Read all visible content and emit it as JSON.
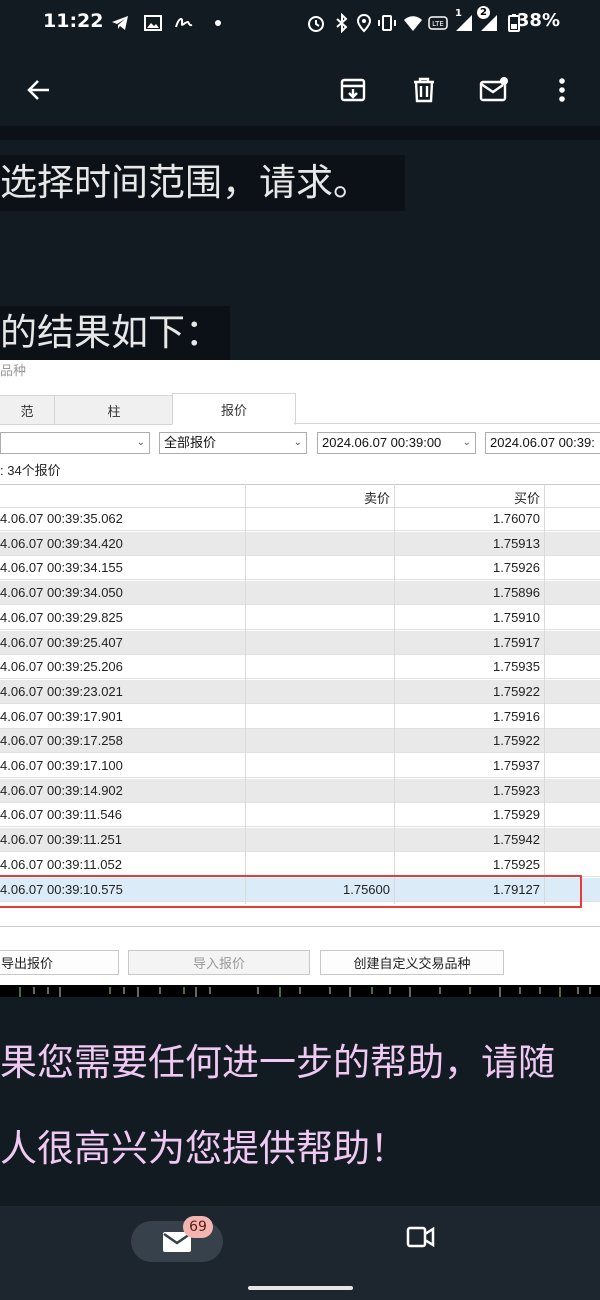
{
  "status_bar": {
    "time": "11:22",
    "battery_pct": "38%",
    "icons": [
      "telegram-icon",
      "image-icon",
      "signature-icon",
      "dot-icon",
      "alarm-icon",
      "bluetooth-icon",
      "location-icon",
      "vibrate-icon",
      "wifi-6-icon",
      "volte-icon",
      "signal-1-icon",
      "signal-2-icon",
      "battery-icon"
    ],
    "sim1_label": "1",
    "sim2_label": "2"
  },
  "action_bar": {
    "icons": [
      "back-arrow-icon",
      "archive-icon",
      "delete-icon",
      "mark-unread-icon",
      "more-vert-icon"
    ]
  },
  "message": {
    "line1": "选择时间范围，请求。",
    "line2": "的结果如下：",
    "line3": "果您需要任何进一步的帮助，请随",
    "line4": "人很高兴为您提供帮助！"
  },
  "panel": {
    "title": "品种",
    "tabs": [
      "范",
      "柱",
      "报价"
    ],
    "active_tab": "报价",
    "filter_select_value": "",
    "quote_type_value": "全部报价",
    "date_from": "2024.06.07 00:39:00",
    "date_to": "2024.06.07 00:39:",
    "count_text": ": 34个报价",
    "columns": {
      "sell": "卖价",
      "buy": "买价"
    },
    "rows": [
      {
        "time": "4.06.07 00:39:35.062",
        "sell": "",
        "buy": "1.76070"
      },
      {
        "time": "4.06.07 00:39:34.420",
        "sell": "",
        "buy": "1.75913"
      },
      {
        "time": "4.06.07 00:39:34.155",
        "sell": "",
        "buy": "1.75926"
      },
      {
        "time": "4.06.07 00:39:34.050",
        "sell": "",
        "buy": "1.75896"
      },
      {
        "time": "4.06.07 00:39:29.825",
        "sell": "",
        "buy": "1.75910"
      },
      {
        "time": "4.06.07 00:39:25.407",
        "sell": "",
        "buy": "1.75917"
      },
      {
        "time": "4.06.07 00:39:25.206",
        "sell": "",
        "buy": "1.75935"
      },
      {
        "time": "4.06.07 00:39:23.021",
        "sell": "",
        "buy": "1.75922"
      },
      {
        "time": "4.06.07 00:39:17.901",
        "sell": "",
        "buy": "1.75916"
      },
      {
        "time": "4.06.07 00:39:17.258",
        "sell": "",
        "buy": "1.75922"
      },
      {
        "time": "4.06.07 00:39:17.100",
        "sell": "",
        "buy": "1.75937"
      },
      {
        "time": "4.06.07 00:39:14.902",
        "sell": "",
        "buy": "1.75923"
      },
      {
        "time": "4.06.07 00:39:11.546",
        "sell": "",
        "buy": "1.75929"
      },
      {
        "time": "4.06.07 00:39:11.251",
        "sell": "",
        "buy": "1.75942"
      },
      {
        "time": "4.06.07 00:39:11.052",
        "sell": "",
        "buy": "1.75925"
      },
      {
        "time": "4.06.07 00:39:10.575",
        "sell": "1.75600",
        "buy": "1.79127"
      }
    ],
    "buttons": {
      "export": "导出报价",
      "import": "导入报价",
      "create": "创建自定义交易品种"
    }
  },
  "bottom_nav": {
    "mail_badge": "69",
    "icons": [
      "mail-icon",
      "video-icon"
    ]
  },
  "colors": {
    "background": "#121a22",
    "pink_text": "#f0c9f3",
    "highlight_border": "#e53b3b",
    "badge": "#f4b5b0"
  }
}
